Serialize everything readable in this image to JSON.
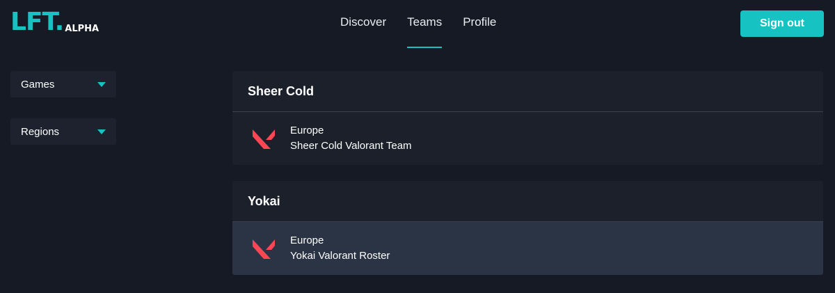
{
  "header": {
    "logo_main": "LFT.",
    "logo_sub": "ALPHA",
    "nav": [
      {
        "label": "Discover",
        "active": false
      },
      {
        "label": "Teams",
        "active": true
      },
      {
        "label": "Profile",
        "active": false
      }
    ],
    "signout_label": "Sign out"
  },
  "filters": [
    {
      "label": "Games"
    },
    {
      "label": "Regions"
    }
  ],
  "teams": [
    {
      "name": "Sheer Cold",
      "region": "Europe",
      "description": "Sheer Cold Valorant Team",
      "game_icon": "valorant-icon"
    },
    {
      "name": "Yokai",
      "region": "Europe",
      "description": "Yokai Valorant Roster",
      "game_icon": "valorant-icon"
    }
  ],
  "colors": {
    "accent": "#19c2c2",
    "background": "#151a25",
    "card": "#1b202b",
    "row_hover": "#2b3445",
    "valorant_red": "#ff4655"
  }
}
